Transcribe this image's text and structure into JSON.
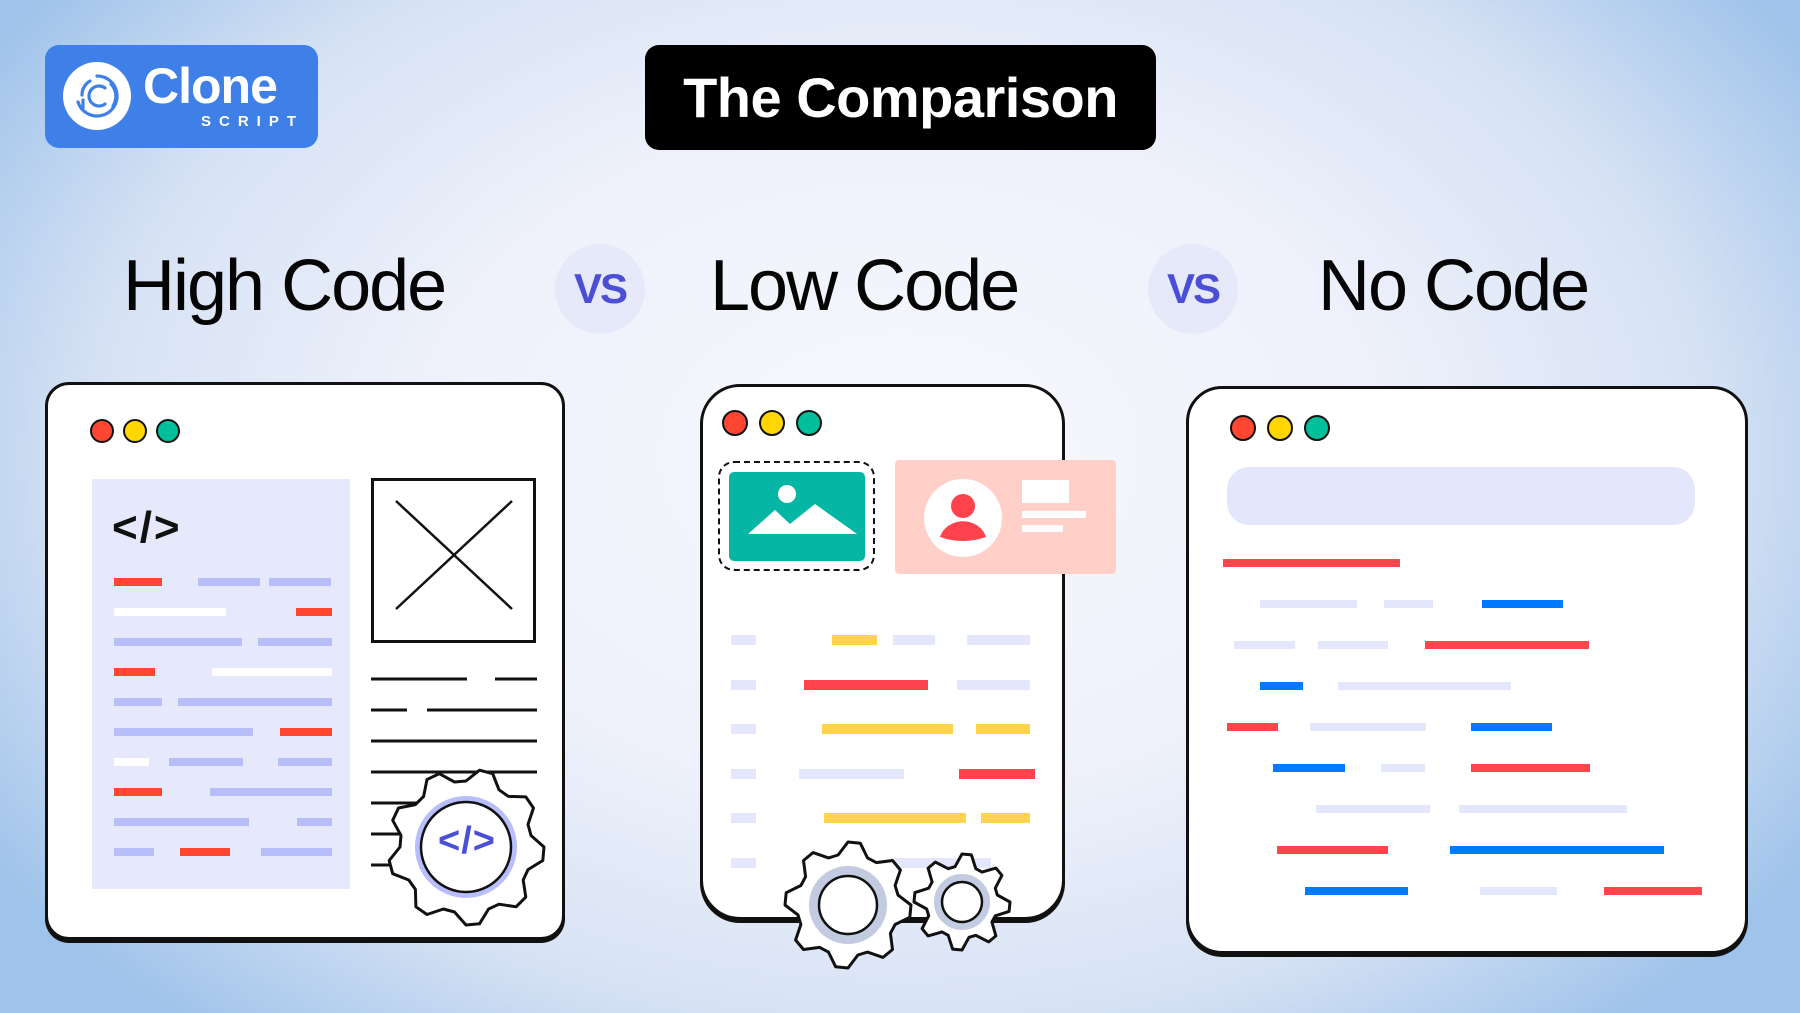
{
  "brand": {
    "name": "Clone",
    "subtitle": "SCRIPT",
    "color": "#3f80e8"
  },
  "title": "The Comparison",
  "comparison": {
    "items": [
      {
        "label": "High Code",
        "icon": "code-window-illustration"
      },
      {
        "label": "Low Code",
        "icon": "drag-and-drop-window-illustration"
      },
      {
        "label": "No Code",
        "icon": "visual-builder-window-illustration"
      }
    ],
    "separator": "VS",
    "separator_color": "#4a4fd6"
  },
  "high_code_panel": {
    "code_glyph": "</>",
    "gear_glyph": "</>"
  },
  "colors": {
    "window_red": "#ff4630",
    "window_yellow": "#ffd600",
    "window_green": "#00bf9a",
    "code_red": "#ff4630",
    "code_lavender": "#b8befa",
    "lowcode_yellow": "#ffd34f",
    "lowcode_red": "#ff424b",
    "lowcode_light": "#e4e7fb",
    "nocode_blue": "#007bff",
    "nocode_red": "#ff454c",
    "image_teal": "#06b6a5",
    "profile_card": "#ffd0c7"
  }
}
